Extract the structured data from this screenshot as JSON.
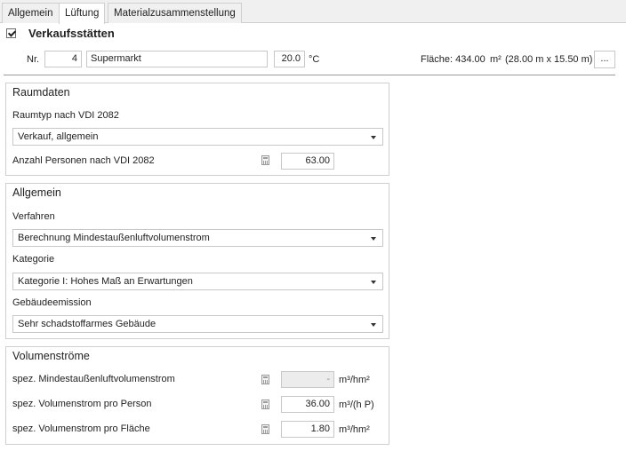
{
  "tabs": [
    {
      "label": "Allgemein"
    },
    {
      "label": "Lüftung"
    },
    {
      "label": "Materialzusammenstellung"
    }
  ],
  "header": {
    "title": "Verkaufsstätten",
    "nr_label": "Nr.",
    "nr_value": "4",
    "name_value": "Supermarkt",
    "temp_value": "20.0",
    "temp_unit": "°C",
    "flaeche_label": "Fläche: 434.00",
    "flaeche_unit": "m²",
    "flaeche_dims": "(28.00 m x 15.50 m)",
    "more_button": "..."
  },
  "raumdaten": {
    "title": "Raumdaten",
    "raumtyp_label": "Raumtyp nach VDI 2082",
    "raumtyp_value": "Verkauf, allgemein",
    "personen_label": "Anzahl Personen nach VDI 2082",
    "personen_value": "63.00"
  },
  "allgemein": {
    "title": "Allgemein",
    "verfahren_label": "Verfahren",
    "verfahren_value": "Berechnung Mindestaußenluftvolumenstrom",
    "kategorie_label": "Kategorie",
    "kategorie_value": "Kategorie I: Hohes Maß an Erwartungen",
    "emission_label": "Gebäudeemission",
    "emission_value": "Sehr schadstoffarmes Gebäude"
  },
  "volumenstroeme": {
    "title": "Volumenströme",
    "rows": [
      {
        "label": "spez. Mindestaußenluftvolumenstrom",
        "value": "-",
        "unit": "m³/hm²"
      },
      {
        "label": "spez. Volumenstrom pro Person",
        "value": "36.00",
        "unit": "m³/(h P)"
      },
      {
        "label": "spez. Volumenstrom pro Fläche",
        "value": "1.80",
        "unit": "m³/hm²"
      }
    ]
  }
}
